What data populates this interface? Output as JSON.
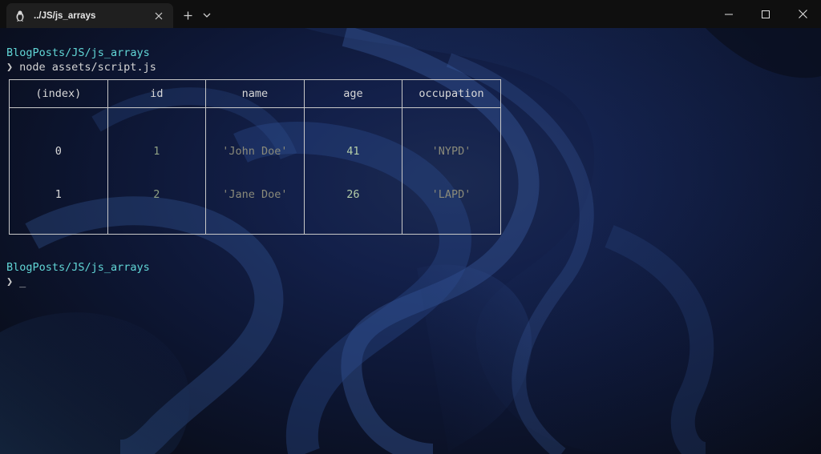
{
  "tab": {
    "title": "../JS/js_arrays",
    "icon": "linux-penguin-icon"
  },
  "window_controls": [
    "minimize",
    "maximize",
    "close"
  ],
  "terminal": {
    "path1": "BlogPosts/JS/js_arrays",
    "prompt_symbol": "❯",
    "command": "node assets/script.js",
    "table": {
      "headers": [
        "(index)",
        "id",
        "name",
        "age",
        "occupation"
      ],
      "rows": [
        {
          "index": "0",
          "id": "1",
          "name": "'John Doe'",
          "age": "41",
          "occupation": "'NYPD'"
        },
        {
          "index": "1",
          "id": "2",
          "name": "'Jane Doe'",
          "age": "26",
          "occupation": "'LAPD'"
        }
      ]
    },
    "path2": "BlogPosts/JS/js_arrays",
    "cursor": "_"
  },
  "colors": {
    "path": "#61d6d6",
    "number": "#b5cea8",
    "string": "#8a8a7a",
    "titlebar": "#0f0f0f",
    "active_tab": "#1f1f1f"
  }
}
